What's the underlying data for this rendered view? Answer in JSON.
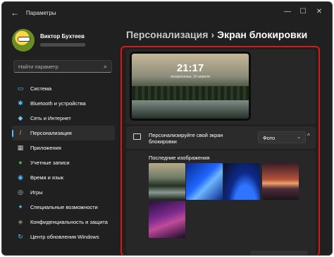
{
  "window": {
    "title": "Параметры",
    "back_icon": "←",
    "minimize_icon": "—",
    "maximize_icon": "☐",
    "close_icon": "✕"
  },
  "profile": {
    "name": "Виктор Бухтеев"
  },
  "search": {
    "placeholder": "Найти параметр",
    "icon": "⌕"
  },
  "sidebar": {
    "items": [
      {
        "label": "Система",
        "icon": "monitor-icon",
        "glyph": "▭",
        "color": "#4cc2ff"
      },
      {
        "label": "Bluetooth и устройства",
        "icon": "bluetooth-icon",
        "glyph": "✱",
        "color": "#4cc2ff"
      },
      {
        "label": "Сеть и Интернет",
        "icon": "wifi-icon",
        "glyph": "◆",
        "color": "#6cc4ff"
      },
      {
        "label": "Персонализация",
        "icon": "brush-icon",
        "glyph": "/",
        "color": "#f7a24a"
      },
      {
        "label": "Приложения",
        "icon": "apps-icon",
        "glyph": "▦",
        "color": "#c4c4c4"
      },
      {
        "label": "Учетные записи",
        "icon": "person-icon",
        "glyph": "●",
        "color": "#3fb950"
      },
      {
        "label": "Время и язык",
        "icon": "globe-clock-icon",
        "glyph": "◉",
        "color": "#4cc2ff"
      },
      {
        "label": "Игры",
        "icon": "gamepad-icon",
        "glyph": "◎",
        "color": "#c4c4c4"
      },
      {
        "label": "Специальные возможности",
        "icon": "accessibility-icon",
        "glyph": "✦",
        "color": "#4cc2ff"
      },
      {
        "label": "Конфиденциальность и защита",
        "icon": "shield-icon",
        "glyph": "◈",
        "color": "#8a8a8a"
      },
      {
        "label": "Центр обновления Windows",
        "icon": "update-icon",
        "glyph": "↻",
        "color": "#4cc2ff"
      }
    ],
    "active_index": 3
  },
  "breadcrumb": {
    "parent": "Персонализация",
    "separator": "›",
    "current": "Экран блокировки"
  },
  "lock_preview": {
    "time": "21:17",
    "date": "воскресенье, 16 апреля"
  },
  "lock_setting": {
    "label": "Персонализируйте свой экран блокировки",
    "selected_option": "Фото",
    "chevron": "⌄",
    "collapse_icon": "^"
  },
  "recent_images": {
    "title": "Последние изображения",
    "thumbnails": [
      "landscape-lake",
      "blue-bloom",
      "blue-glow",
      "sunset-road",
      "purple-abstract"
    ]
  },
  "colors": {
    "accent": "#4cc2ff",
    "highlight_border": "#e01515",
    "window_bg": "#202020"
  }
}
